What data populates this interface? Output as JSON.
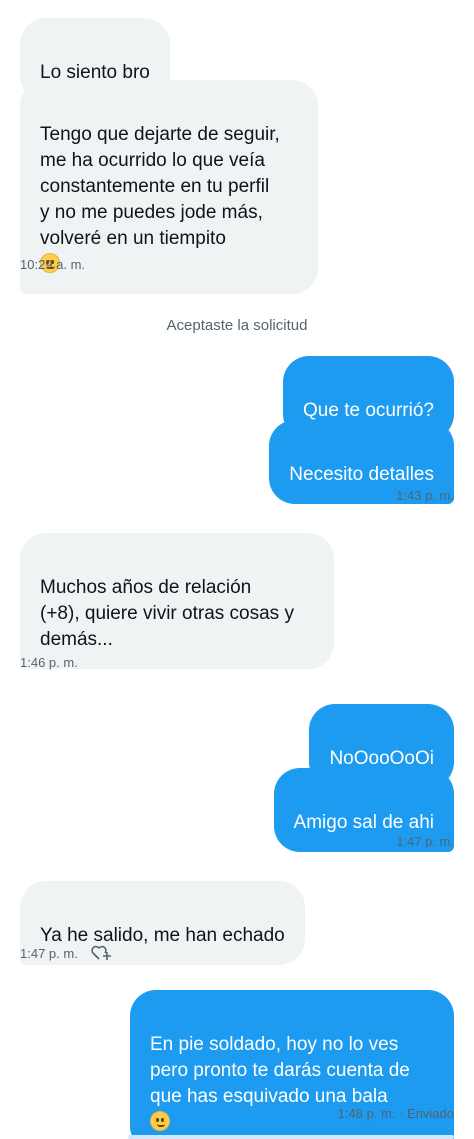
{
  "colors": {
    "incoming_bg": "#eff3f4",
    "outgoing_bg": "#1d9bf0",
    "meta_text": "#536471"
  },
  "messages": {
    "m1": "Lo siento bro",
    "m2": "Tengo que dejarte de seguir,\nme ha ocurrido lo que veía\nconstantemente en tu perfil\ny no me puedes jode más,\nvolveré en un tiempito",
    "t1": "10:29 a. m.",
    "system": "Aceptaste la solicitud",
    "m3": "Que te ocurrió?",
    "m4": "Necesito detalles",
    "t2": "1:43 p. m.",
    "m5": "Muchos años de relación\n(+8), quiere vivir otras cosas y\ndemás...",
    "t3": "1:46 p. m.",
    "m6": "NoOooOoOi",
    "m7": "Amigo sal de ahi",
    "t4": "1:47 p. m.",
    "m8": "Ya he salido, me han echado",
    "t5": "1:47 p. m.",
    "m9": "En pie soldado, hoy no lo ves\npero pronto te darás cuenta de\nque has esquivado una bala",
    "t6": "1:48 p. m. · Enviado"
  },
  "icons": {
    "emoji": "smiling-face-with-tear",
    "react": "heart-plus-icon"
  }
}
